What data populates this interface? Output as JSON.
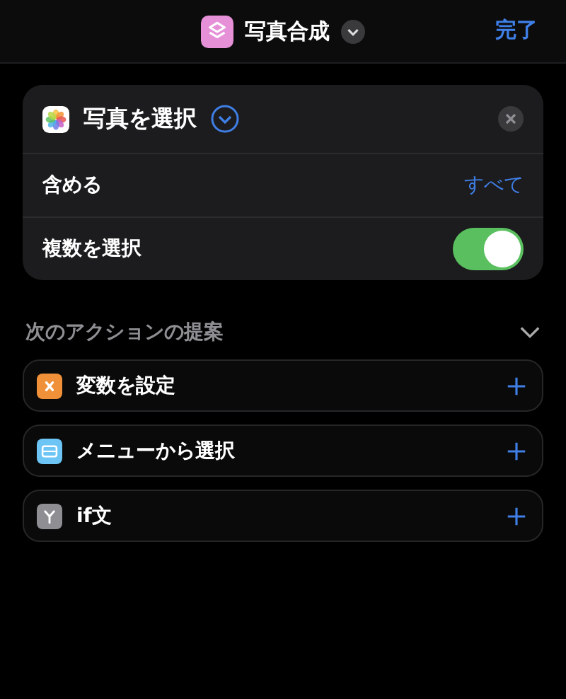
{
  "header": {
    "title": "写真合成",
    "done": "完了"
  },
  "action": {
    "title": "写真を選択",
    "options": [
      {
        "kind": "value",
        "label": "含める",
        "value": "すべて"
      },
      {
        "kind": "toggle",
        "label": "複数を選択",
        "on": true
      }
    ]
  },
  "suggestions": {
    "title": "次のアクションの提案",
    "expanded": true,
    "items": [
      {
        "kind": "variable",
        "label": "変数を設定",
        "color": "#f0913a"
      },
      {
        "kind": "menu",
        "label": "メニューから選択",
        "color": "#6cc5f5"
      },
      {
        "kind": "if",
        "label": "if文",
        "color": "#8e8e93"
      }
    ]
  }
}
